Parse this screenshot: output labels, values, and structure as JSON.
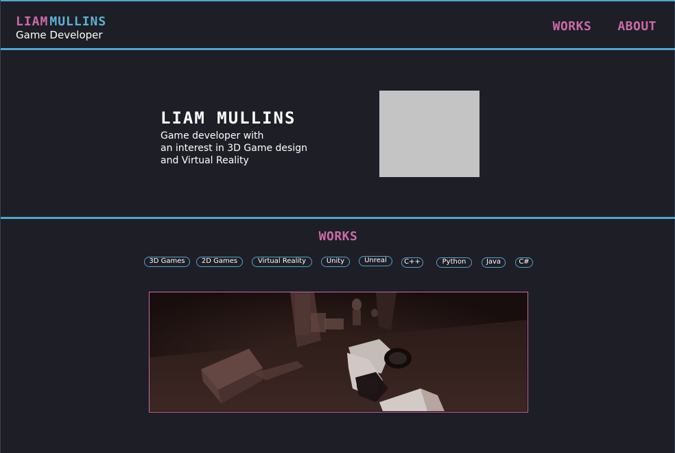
{
  "header": {
    "first_name": "LIAM",
    "last_name": "MULLINS",
    "subtitle": "Game Developer",
    "nav": [
      {
        "label": "WORKS"
      },
      {
        "label": "ABOUT"
      }
    ]
  },
  "hero": {
    "title": "LIAM MULLINS",
    "lines": [
      "Game developer with",
      "an interest in 3D Game design",
      "and Virtual Reality"
    ]
  },
  "works": {
    "title": "WORKS",
    "tags": [
      {
        "label": "3D Games"
      },
      {
        "label": "2D Games"
      },
      {
        "label": "Virtual Reality"
      },
      {
        "label": "Unity"
      },
      {
        "label": "Unreal"
      },
      {
        "label": "C++"
      },
      {
        "label": "Python"
      },
      {
        "label": "Java"
      },
      {
        "label": "C#"
      }
    ]
  },
  "colors": {
    "background": "#1e1e26",
    "accent_blue": "#4fa8d1",
    "accent_pink": "#cc6aa8",
    "placeholder_gray": "#c4c4c4"
  }
}
